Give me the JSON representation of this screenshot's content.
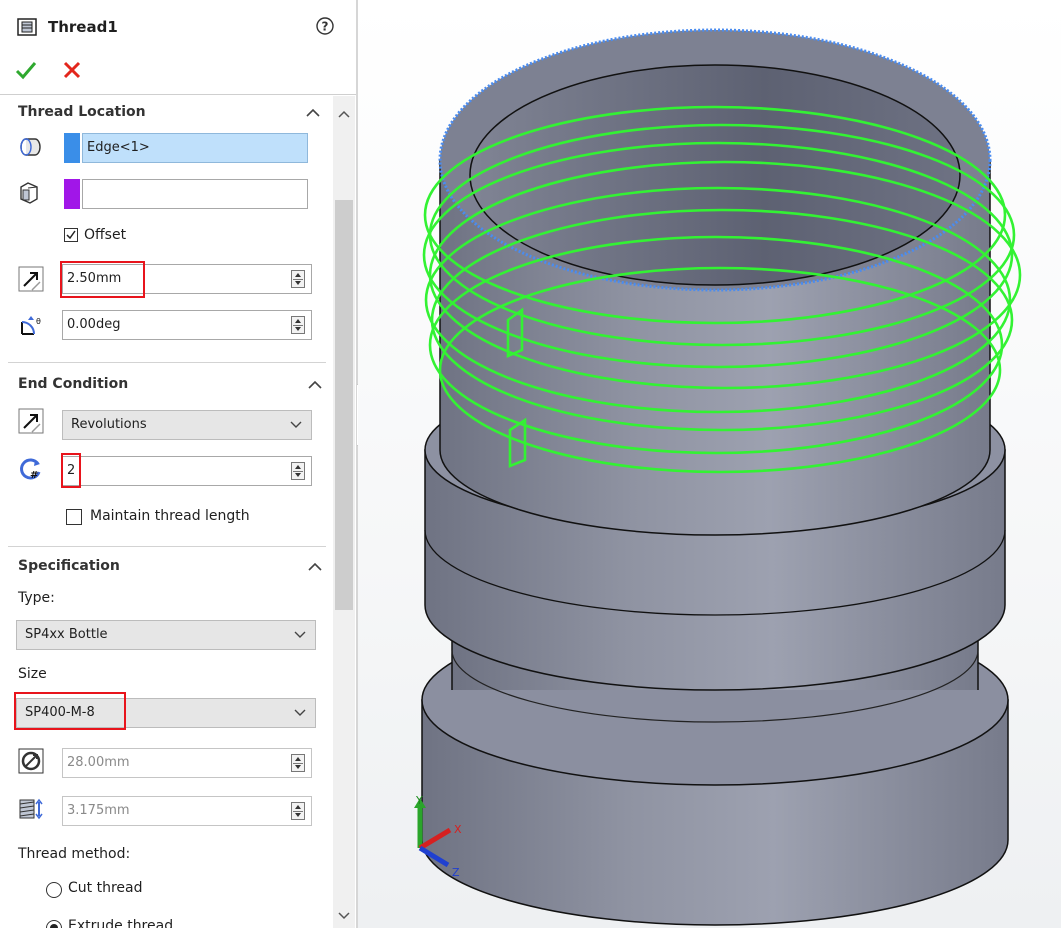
{
  "panel": {
    "title": "Thread1",
    "help_icon": "help-circle-icon",
    "ok_icon": "checkmark-icon",
    "cancel_icon": "x-icon",
    "thread_location": {
      "title": "Thread Location",
      "edge_value": "Edge<1>",
      "face_value": "",
      "offset_label": "Offset",
      "offset_checked": true,
      "offset_distance": "2.50mm",
      "start_angle": "0.00deg"
    },
    "end_condition": {
      "title": "End Condition",
      "type_value": "Revolutions",
      "revolutions": "2",
      "maintain_label": "Maintain thread length",
      "maintain_checked": false
    },
    "specification": {
      "title": "Specification",
      "type_label": "Type:",
      "type_value": "SP4xx Bottle",
      "size_label": "Size",
      "size_value": "SP400-M-8",
      "diameter": "28.00mm",
      "pitch": "3.175mm",
      "method_label": "Thread method:",
      "cut_label": "Cut thread",
      "extrude_label": "Extrude thread",
      "selected_method": "extrude"
    }
  },
  "viewport": {
    "triad_x": "X",
    "triad_y": "Y",
    "triad_z": "Z",
    "thread_color": "#33f233",
    "model_color": "#8a8d9b",
    "selection_color": "#4a8cf0"
  }
}
